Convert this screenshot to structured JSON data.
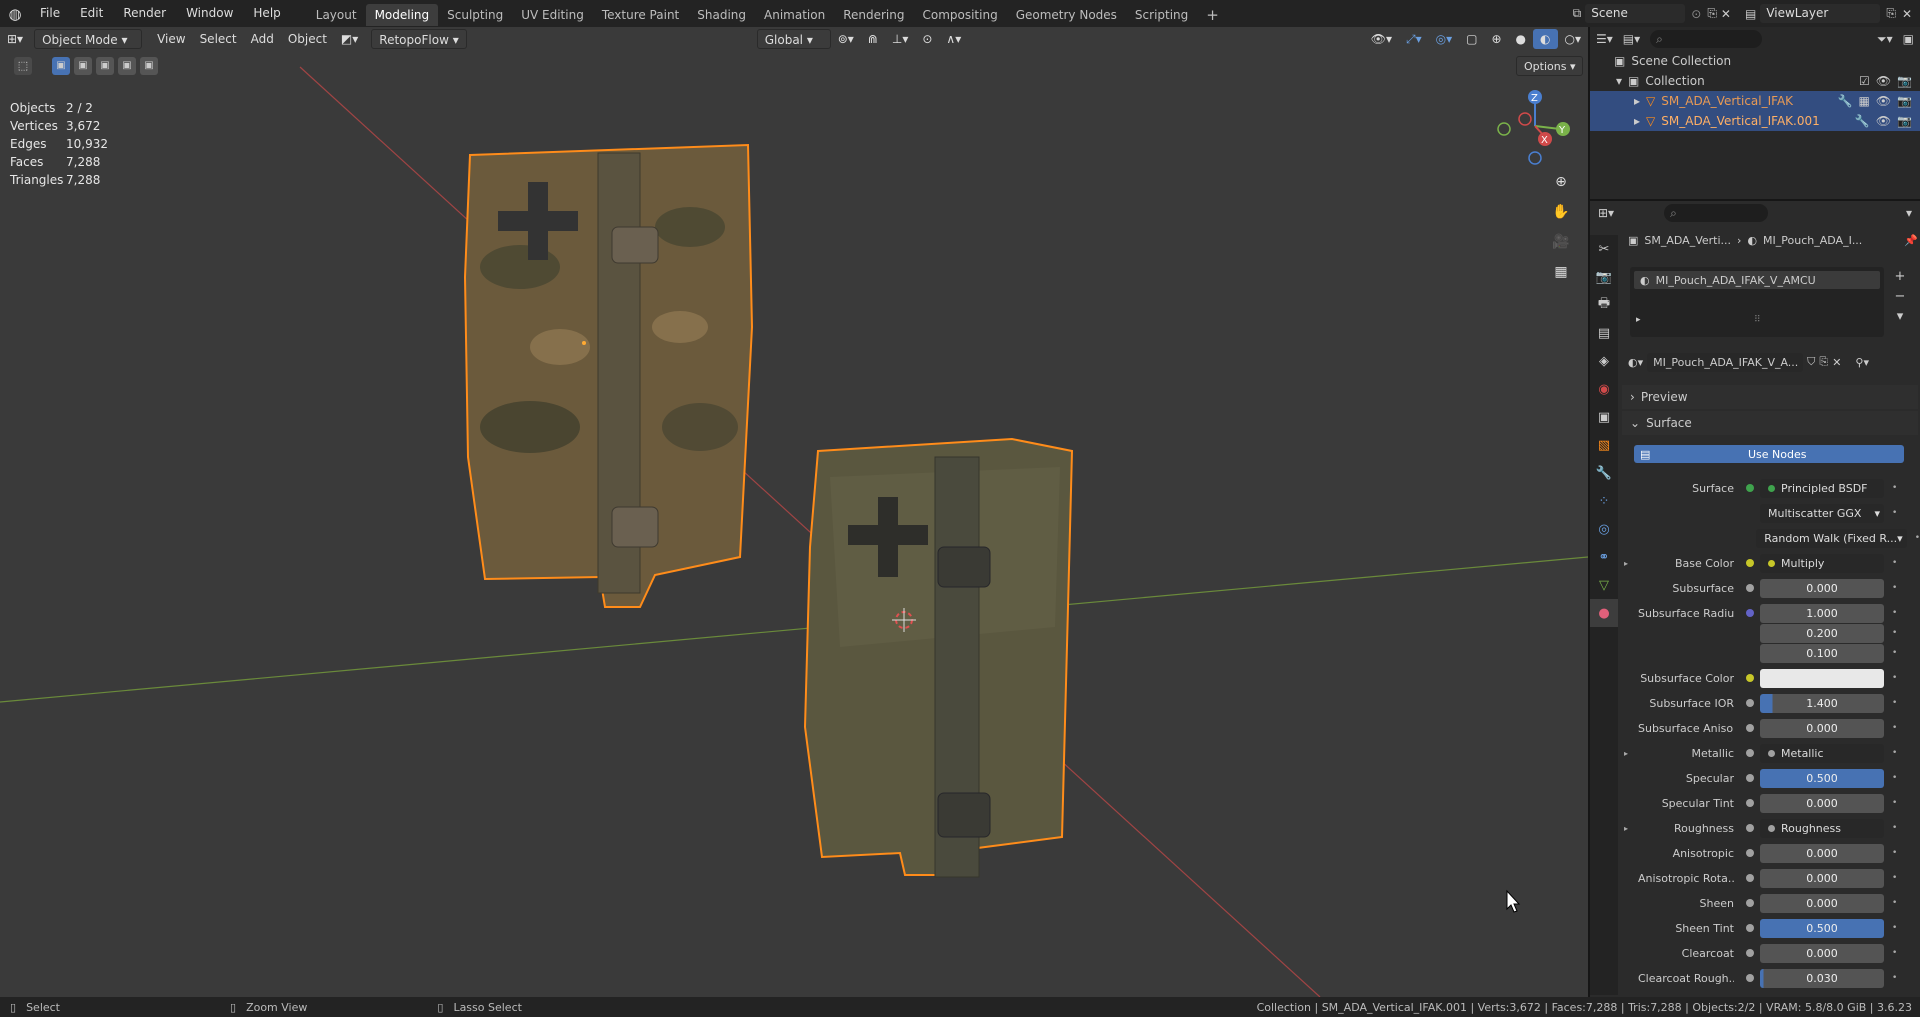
{
  "topbar": {
    "menus": [
      "File",
      "Edit",
      "Render",
      "Window",
      "Help"
    ],
    "workspaces": [
      "Layout",
      "Modeling",
      "Sculpting",
      "UV Editing",
      "Texture Paint",
      "Shading",
      "Animation",
      "Rendering",
      "Compositing",
      "Geometry Nodes",
      "Scripting"
    ],
    "active_workspace": "Modeling",
    "scene": "Scene",
    "view_layer": "ViewLayer"
  },
  "viewport": {
    "mode": "Object Mode",
    "menus": [
      "View",
      "Select",
      "Add",
      "Object"
    ],
    "addon": "RetopoFlow",
    "transform_orientation": "Global",
    "options_label": "Options",
    "stats": [
      {
        "k": "Objects",
        "v": "2 / 2"
      },
      {
        "k": "Vertices",
        "v": "3,672"
      },
      {
        "k": "Edges",
        "v": "10,932"
      },
      {
        "k": "Faces",
        "v": "7,288"
      },
      {
        "k": "Triangles",
        "v": "7,288"
      }
    ],
    "gizmo": {
      "x": "X",
      "y": "Y",
      "z": "Z"
    }
  },
  "outliner": {
    "root": "Scene Collection",
    "collection": "Collection",
    "objects": [
      "SM_ADA_Vertical_IFAK",
      "SM_ADA_Vertical_IFAK.001"
    ]
  },
  "properties": {
    "breadcrumb_object": "SM_ADA_Verti...",
    "breadcrumb_material": "MI_Pouch_ADA_I...",
    "slot_material": "MI_Pouch_ADA_IFAK_V_AMCU",
    "datablock_name": "MI_Pouch_ADA_IFAK_V_A...",
    "panel_preview": "Preview",
    "panel_surface": "Surface",
    "use_nodes": "Use Nodes",
    "rows": [
      {
        "label": "Surface",
        "kind": "field",
        "value": "Principled BSDF",
        "dot": "#3fa34d"
      },
      {
        "label": "",
        "kind": "dropdown",
        "value": "Multiscatter GGX"
      },
      {
        "label": "",
        "kind": "dropdown",
        "value": "Random Walk (Fixed R..."
      },
      {
        "label": "Base Color",
        "kind": "field",
        "value": "Multiply",
        "dot": "#c7c729",
        "expand": true
      },
      {
        "label": "Subsurface",
        "kind": "num",
        "value": "0.000"
      },
      {
        "label": "Subsurface Radius",
        "kind": "num",
        "value": "1.000",
        "dot": "#6363c7"
      },
      {
        "label": "",
        "kind": "num",
        "value": "0.200",
        "nodot": true
      },
      {
        "label": "",
        "kind": "num",
        "value": "0.100",
        "nodot": true
      },
      {
        "label": "Subsurface Color",
        "kind": "color",
        "value": "#e8e8e8",
        "dot": "#c7c729"
      },
      {
        "label": "Subsurface IOR",
        "kind": "num",
        "value": "1.400",
        "fill": 0.1
      },
      {
        "label": "Subsurface Aniso...",
        "kind": "num",
        "value": "0.000"
      },
      {
        "label": "Metallic",
        "kind": "field",
        "value": "Metallic",
        "expand": true
      },
      {
        "label": "Specular",
        "kind": "num",
        "value": "0.500",
        "fill": 1
      },
      {
        "label": "Specular Tint",
        "kind": "num",
        "value": "0.000"
      },
      {
        "label": "Roughness",
        "kind": "field",
        "value": "Roughness",
        "expand": true
      },
      {
        "label": "Anisotropic",
        "kind": "num",
        "value": "0.000"
      },
      {
        "label": "Anisotropic Rota...",
        "kind": "num",
        "value": "0.000"
      },
      {
        "label": "Sheen",
        "kind": "num",
        "value": "0.000"
      },
      {
        "label": "Sheen Tint",
        "kind": "num",
        "value": "0.500",
        "fill": 1
      },
      {
        "label": "Clearcoat",
        "kind": "num",
        "value": "0.000"
      },
      {
        "label": "Clearcoat Rough...",
        "kind": "num",
        "value": "0.030",
        "fill": 0.03
      }
    ]
  },
  "statusbar": {
    "select": "Select",
    "zoom": "Zoom View",
    "lasso": "Lasso Select",
    "info": "Collection | SM_ADA_Vertical_IFAK.001 | Verts:3,672 | Faces:7,288 | Tris:7,288 | Objects:2/2 | VRAM: 5.8/8.0 GiB | 3.6.23"
  },
  "colors": {
    "accent": "#4772b3",
    "selected": "#ff8c1a",
    "selected_text": "#e89a55"
  }
}
